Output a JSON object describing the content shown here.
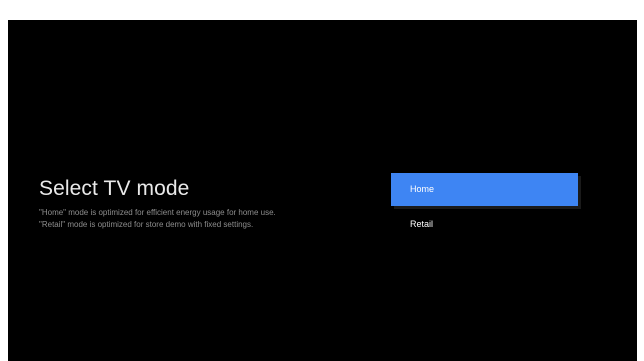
{
  "screen": {
    "title": "Select TV mode",
    "description_lines": [
      "\"Home\" mode is optimized for efficient energy usage for home use.",
      "\"Retail\" mode is optimized for store demo with fixed settings."
    ]
  },
  "menu": {
    "selected_index": 0,
    "items": [
      {
        "label": "Home"
      },
      {
        "label": "Retail"
      }
    ]
  },
  "colors": {
    "background": "#000000",
    "selection": "#3e85f3",
    "title_text": "#e9e9e9",
    "description_text": "#8d8d8d"
  }
}
